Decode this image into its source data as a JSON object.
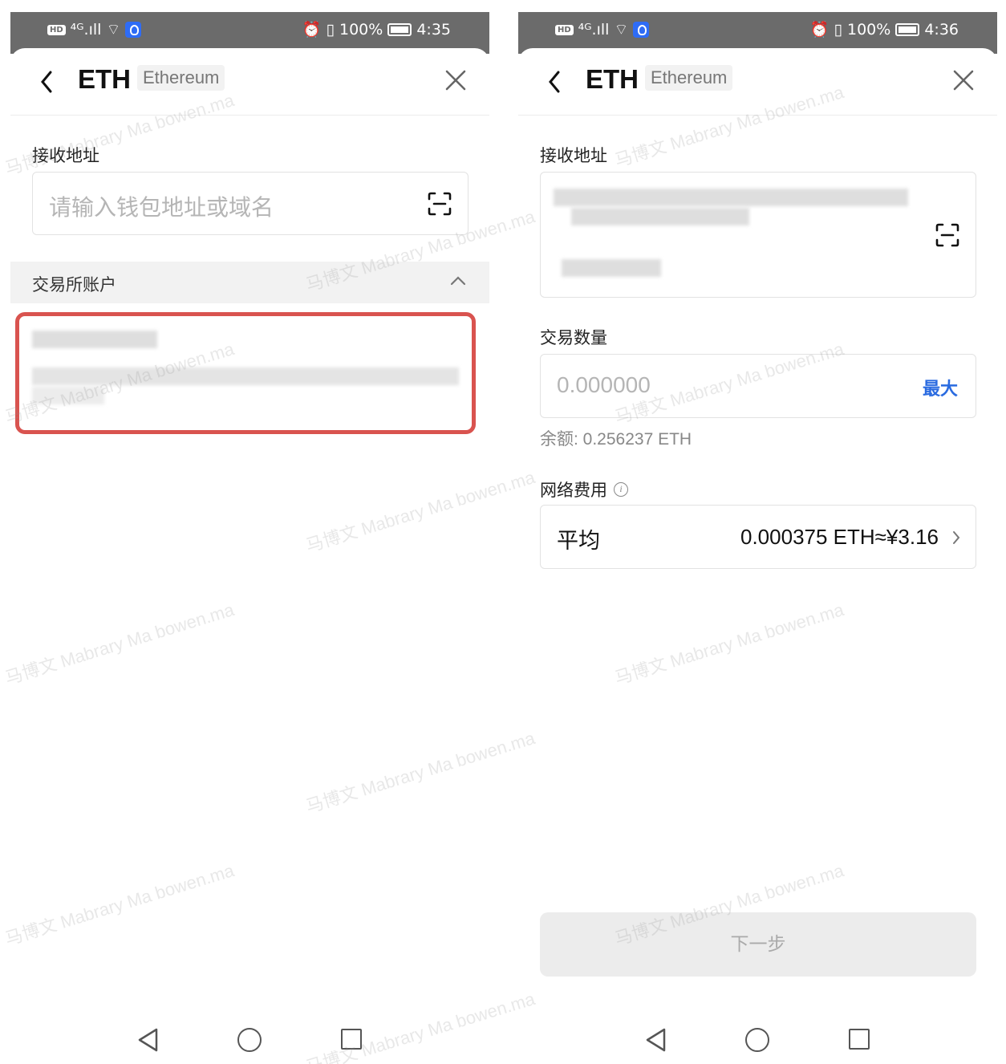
{
  "left_screen": {
    "status_bar": {
      "hd": "HD",
      "network": "⁴ᴳ.ıll",
      "battery": "100%",
      "time": "4:35"
    },
    "header": {
      "symbol": "ETH",
      "chain": "Ethereum"
    },
    "address": {
      "label": "接收地址",
      "placeholder": "请输入钱包地址或域名"
    },
    "exchange_section": {
      "label": "交易所账户"
    }
  },
  "right_screen": {
    "status_bar": {
      "hd": "HD",
      "network": "⁴ᴳ.ıll",
      "battery": "100%",
      "time": "4:36"
    },
    "header": {
      "symbol": "ETH",
      "chain": "Ethereum"
    },
    "address": {
      "label": "接收地址"
    },
    "amount": {
      "label": "交易数量",
      "placeholder": "0.000000",
      "max_label": "最大",
      "balance": "余额: 0.256237 ETH"
    },
    "fee": {
      "label": "网络费用",
      "info": "i",
      "speed": "平均",
      "value": "0.000375 ETH≈¥3.16"
    },
    "next_button": "下一步"
  },
  "watermark": "马博文 Mabrary Ma bowen.ma",
  "colors": {
    "highlight": "#d9534f",
    "accent": "#2a6be0",
    "status_bar": "#6b6b6b"
  }
}
